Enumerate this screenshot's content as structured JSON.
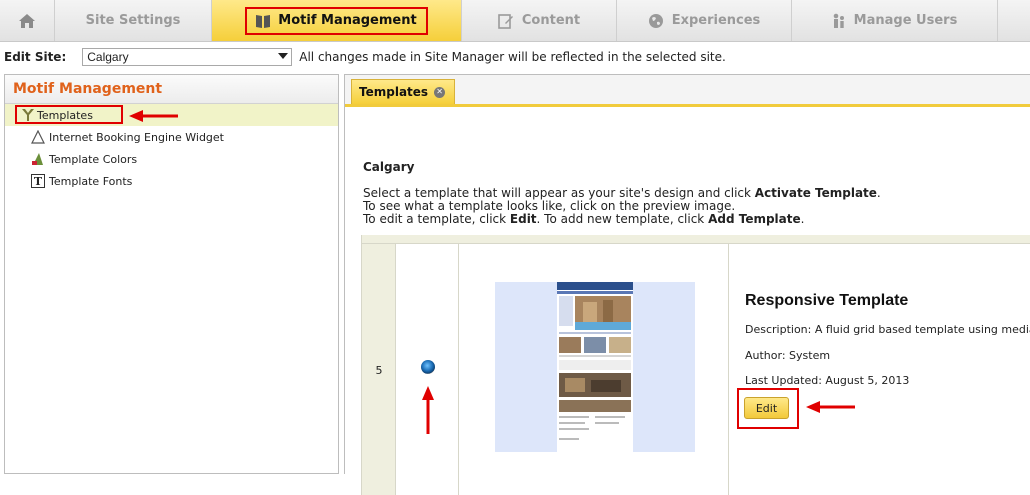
{
  "nav": {
    "tabs": [
      {
        "label": "",
        "icon": "home-icon"
      },
      {
        "label": "Site Settings"
      },
      {
        "label": "Motif Management",
        "icon": "book-icon",
        "active": true
      },
      {
        "label": "Content",
        "icon": "edit-icon"
      },
      {
        "label": "Experiences",
        "icon": "globe-icon"
      },
      {
        "label": "Manage Users",
        "icon": "users-icon"
      }
    ]
  },
  "site_bar": {
    "label": "Edit Site:",
    "selected_site": "Calgary",
    "note": "All changes made in Site Manager will be reflected in the selected site."
  },
  "left_panel": {
    "title": "Motif Management",
    "items": [
      {
        "label": "Templates",
        "icon": "template-icon",
        "selected": true
      },
      {
        "label": "Internet Booking Engine Widget",
        "icon": "widget-icon"
      },
      {
        "label": "Template Colors",
        "icon": "palette-icon"
      },
      {
        "label": "Template Fonts",
        "icon": "font-icon"
      }
    ]
  },
  "content": {
    "tab_label": "Templates",
    "site_name": "Calgary",
    "instructions": {
      "line1_pre": "Select a template that will appear as your site's design and click ",
      "line1_bold": "Activate Template",
      "line1_post": ".",
      "line2": "To see what a template looks like, click on the preview image.",
      "line3_pre": "To edit a template, click ",
      "line3_bold": "Edit",
      "line3_mid": ". To add new template, click ",
      "line3_bold2": "Add Template",
      "line3_post": "."
    },
    "template": {
      "row_number": "5",
      "name": "Responsive Template",
      "description": "Description: A fluid grid based template using media queries",
      "author": "Author: System",
      "last_updated": "Last Updated: August 5, 2013",
      "edit_label": "Edit"
    }
  },
  "colors": {
    "accent": "#f5cf3a",
    "highlight_box": "#e00000",
    "panel_title": "#e0621b",
    "selected_row": "#f1f3c8"
  }
}
